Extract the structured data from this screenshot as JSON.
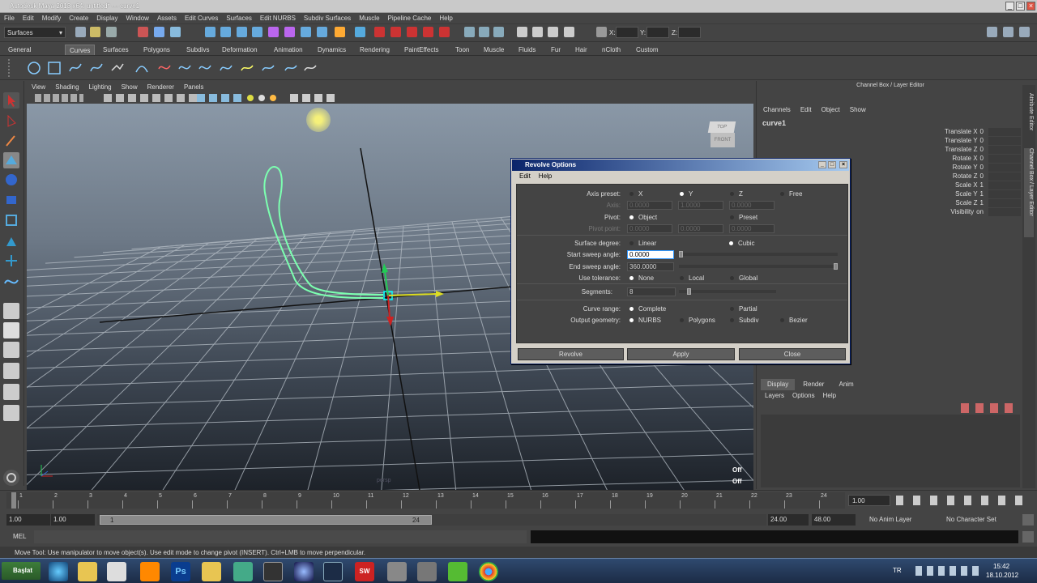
{
  "window": {
    "title": "Autodesk Maya 2013 x64: untitled*   ---   curve1"
  },
  "menus": [
    "File",
    "Edit",
    "Modify",
    "Create",
    "Display",
    "Window",
    "Assets",
    "Edit Curves",
    "Surfaces",
    "Edit NURBS",
    "Subdiv Surfaces",
    "Muscle",
    "Pipeline Cache",
    "Help"
  ],
  "status": {
    "menu_set": "Surfaces",
    "x_label": "X:",
    "y_label": "Y:",
    "z_label": "Z:"
  },
  "shelf_tabs": [
    "General",
    "Curves",
    "Surfaces",
    "Polygons",
    "Subdivs",
    "Deformation",
    "Animation",
    "Dynamics",
    "Rendering",
    "PaintEffects",
    "Toon",
    "Muscle",
    "Fluids",
    "Fur",
    "Hair",
    "nCloth",
    "Custom"
  ],
  "shelf_active": "Curves",
  "viewport": {
    "menus": [
      "View",
      "Shading",
      "Lighting",
      "Show",
      "Renderer",
      "Panels"
    ],
    "cube_top": "TOP",
    "cube_front": "FRONT",
    "hud_off1": "Off",
    "hud_off2": "Off",
    "camera": "persp"
  },
  "channel_box": {
    "title": "Channel Box / Layer Editor",
    "menus": [
      "Channels",
      "Edit",
      "Object",
      "Show"
    ],
    "object": "curve1",
    "attrs": [
      {
        "name": "Translate X",
        "value": "0"
      },
      {
        "name": "Translate Y",
        "value": "0"
      },
      {
        "name": "Translate Z",
        "value": "0"
      },
      {
        "name": "Rotate X",
        "value": "0"
      },
      {
        "name": "Rotate Y",
        "value": "0"
      },
      {
        "name": "Rotate Z",
        "value": "0"
      },
      {
        "name": "Scale X",
        "value": "1"
      },
      {
        "name": "Scale Y",
        "value": "1"
      },
      {
        "name": "Scale Z",
        "value": "1"
      },
      {
        "name": "Visibility",
        "value": "on"
      }
    ],
    "side_tab1": "Attribute Editor",
    "side_tab2": "Channel Box / Layer Editor"
  },
  "layer_editor": {
    "tabs": [
      "Display",
      "Render",
      "Anim"
    ],
    "menus": [
      "Layers",
      "Options",
      "Help"
    ]
  },
  "dialog": {
    "title": "Revolve Options",
    "menus": [
      "Edit",
      "Help"
    ],
    "axis_preset_label": "Axis preset:",
    "axis_preset": [
      "X",
      "Y",
      "Z",
      "Free"
    ],
    "axis_preset_selected": "Y",
    "axis_label": "Axis:",
    "axis_values": [
      "0.0000",
      "1.0000",
      "0.0000"
    ],
    "pivot_label": "Pivot:",
    "pivot": [
      "Object",
      "Preset"
    ],
    "pivot_selected": "Object",
    "pivot_point_label": "Pivot point:",
    "pivot_point_values": [
      "0.0000",
      "0.0000",
      "0.0000"
    ],
    "surface_degree_label": "Surface degree:",
    "surface_degree": [
      "Linear",
      "Cubic"
    ],
    "surface_degree_selected": "Cubic",
    "start_sweep_label": "Start sweep angle:",
    "start_sweep": "0.0000",
    "end_sweep_label": "End sweep angle:",
    "end_sweep": "360.0000",
    "use_tolerance_label": "Use tolerance:",
    "use_tolerance": [
      "None",
      "Local",
      "Global"
    ],
    "use_tolerance_selected": "None",
    "segments_label": "Segments:",
    "segments": "8",
    "curve_range_label": "Curve range:",
    "curve_range": [
      "Complete",
      "Partial"
    ],
    "curve_range_selected": "Complete",
    "output_geometry_label": "Output geometry:",
    "output_geometry": [
      "NURBS",
      "Polygons",
      "Subdiv",
      "Bezier"
    ],
    "output_geometry_selected": "NURBS",
    "buttons": {
      "revolve": "Revolve",
      "apply": "Apply",
      "close": "Close"
    }
  },
  "timeline": {
    "ticks": [
      "1",
      "2",
      "3",
      "4",
      "5",
      "6",
      "7",
      "8",
      "9",
      "10",
      "11",
      "12",
      "13",
      "14",
      "15",
      "16",
      "17",
      "18",
      "19",
      "20",
      "21",
      "22",
      "23",
      "24"
    ],
    "current": "1.00"
  },
  "range": {
    "start": "1.00",
    "inner_start": "1.00",
    "slider_start": "1",
    "slider_end": "24",
    "inner_end": "24.00",
    "end": "48.00",
    "anim_layer": "No Anim Layer",
    "char_set": "No Character Set"
  },
  "mel": {
    "label": "MEL"
  },
  "help": {
    "text": "Move Tool: Use manipulator to move object(s). Use edit mode to change pivot (INSERT). Ctrl+LMB to move perpendicular."
  },
  "taskbar": {
    "start": "Başlat",
    "lang": "TR",
    "time": "15:42",
    "date": "18.10.2012"
  },
  "colors": {
    "ui_bg": "#444444",
    "dialog_title": "#0a246a",
    "curve": "#7cffb0",
    "grid": "#b8c0c8"
  }
}
